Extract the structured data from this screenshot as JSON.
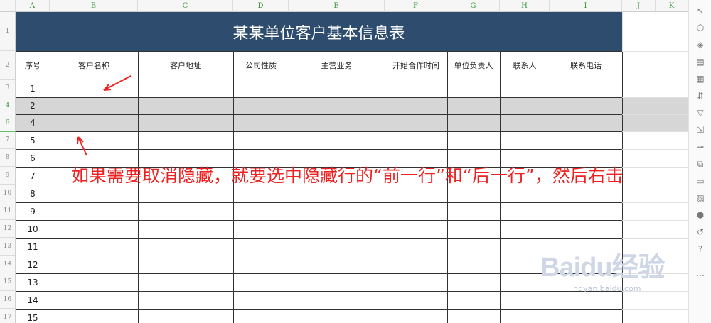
{
  "column_letters": [
    "A",
    "B",
    "C",
    "D",
    "E",
    "F",
    "G",
    "H",
    "I",
    "J",
    "K"
  ],
  "row_numbers": [
    "1",
    "2",
    "3",
    "4",
    "6",
    "7",
    "8",
    "9",
    "10",
    "11",
    "12",
    "13",
    "14",
    "15",
    "16",
    "17"
  ],
  "title": "某某单位客户基本信息表",
  "headers": [
    "序号",
    "客户名称",
    "客户地址",
    "公司性质",
    "主营业务",
    "开始合作时间",
    "单位负责人",
    "联系人",
    "联系电话"
  ],
  "serials": [
    "1",
    "2",
    "4",
    "5",
    "6",
    "7",
    "8",
    "9",
    "10",
    "11",
    "12",
    "13",
    "14",
    "15"
  ],
  "annotation": "如果需要取消隐藏，就要选中隐藏行的“前一行”和“后一行”，然后右击",
  "watermark": {
    "logo": "Baidu经验",
    "url": "jingyan.baidu.com"
  },
  "colors": {
    "title_bg": "#2e4d6e",
    "annotation": "#ee2222",
    "selection": "#6abf6a",
    "hidden_band": "#d6d6d6"
  },
  "toolbar_icons": [
    "cursor-icon",
    "shapes-icon",
    "fill-icon",
    "chart-icon",
    "grid-icon",
    "filter-icon",
    "funnel-icon",
    "collapse-icon",
    "link-icon",
    "copy-icon",
    "save-icon",
    "image-icon",
    "shield-icon",
    "history-icon",
    "help-icon",
    "more-icon"
  ]
}
